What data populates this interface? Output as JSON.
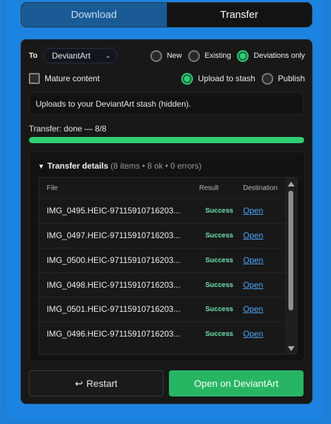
{
  "tabs": [
    {
      "label": "Download",
      "active": true
    },
    {
      "label": "Transfer",
      "active": false
    }
  ],
  "to": {
    "label": "To",
    "selected": "DeviantArt",
    "icon": "chevron-down-icon"
  },
  "mode_options": [
    {
      "label": "New",
      "selected": false
    },
    {
      "label": "Existing",
      "selected": false
    },
    {
      "label": "Deviations only",
      "selected": true
    }
  ],
  "mature": {
    "label": "Mature content",
    "checked": false
  },
  "upload_options": [
    {
      "label": "Upload to stash",
      "selected": true
    },
    {
      "label": "Publish",
      "selected": false
    }
  ],
  "info_text": "Uploads to your DeviantArt stash (hidden).",
  "progress": {
    "label": "Transfer: done — 8/8",
    "done": 8,
    "total": 8,
    "fraction": 1.0
  },
  "details": {
    "title": "Transfer details",
    "meta": "(8 items • 8 ok • 0 errors)",
    "columns": [
      "File",
      "Result",
      "Destination"
    ],
    "rows": [
      {
        "file": "IMG_0495.HEIC-97115910716203...",
        "result": "Success",
        "link": "Open"
      },
      {
        "file": "IMG_0497.HEIC-97115910716203...",
        "result": "Success",
        "link": "Open"
      },
      {
        "file": "IMG_0500.HEIC-97115910716203...",
        "result": "Success",
        "link": "Open"
      },
      {
        "file": "IMG_0498.HEIC-97115910716203...",
        "result": "Success",
        "link": "Open"
      },
      {
        "file": "IMG_0501.HEIC-97115910716203...",
        "result": "Success",
        "link": "Open"
      },
      {
        "file": "IMG_0496.HEIC-97115910716203...",
        "result": "Success",
        "link": "Open"
      }
    ]
  },
  "buttons": {
    "restart": "Restart",
    "restart_icon": "return-arrow-icon",
    "open": "Open on DeviantArt"
  },
  "colors": {
    "accent_green": "#2fcf73",
    "tab_active": "#1a5b95",
    "link": "#4ea6ff",
    "background": "#1e7fd6"
  }
}
